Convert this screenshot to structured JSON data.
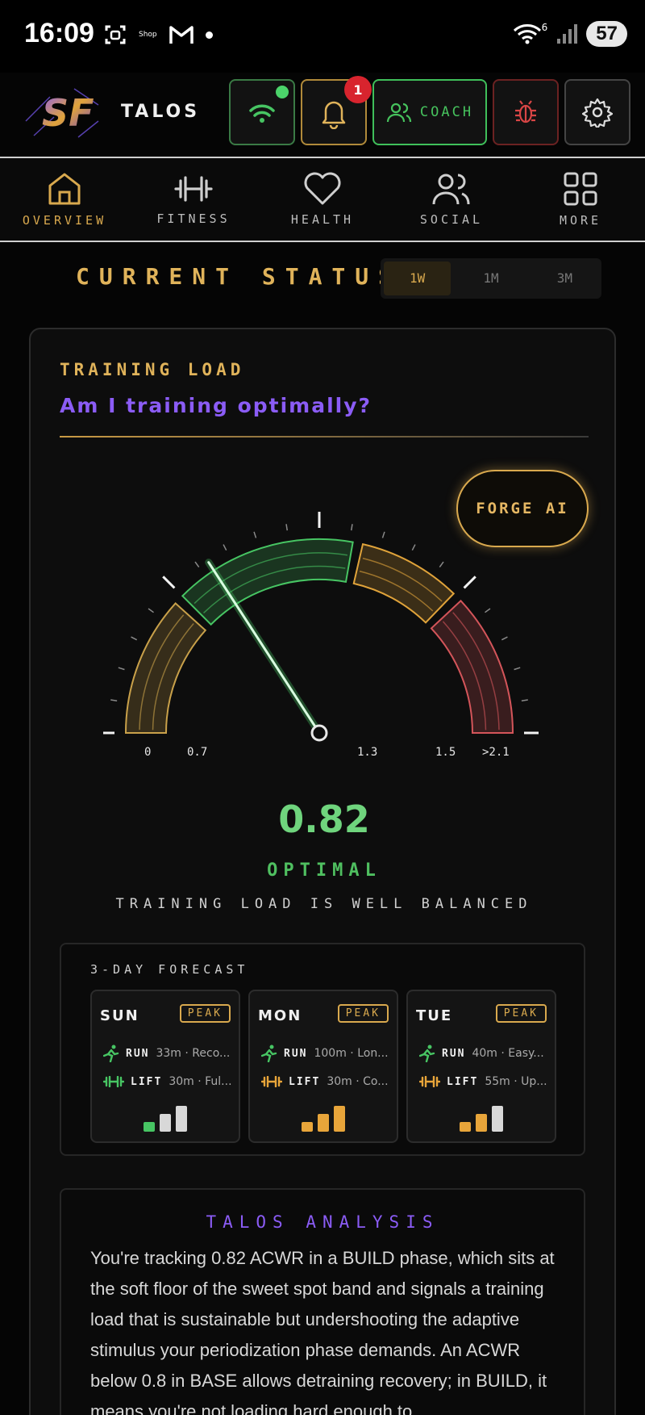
{
  "status_bar": {
    "time": "16:09",
    "shop_label": "Shop",
    "signal_label": "6",
    "battery": "57"
  },
  "header": {
    "app_name": "TALOS",
    "notification_count": "1",
    "coach_label": "COACH"
  },
  "nav": [
    {
      "label": "OVERVIEW",
      "active": true
    },
    {
      "label": "FITNESS",
      "active": false
    },
    {
      "label": "HEALTH",
      "active": false
    },
    {
      "label": "SOCIAL",
      "active": false
    },
    {
      "label": "MORE",
      "active": false
    }
  ],
  "section": {
    "title": "CURRENT STATUS",
    "ranges": [
      "1W",
      "1M",
      "3M"
    ],
    "selected_range": "1W"
  },
  "training_load": {
    "eyebrow": "TRAINING LOAD",
    "question": "Am I training optimally?",
    "scale_labels": [
      "0",
      "0.7",
      "1.3",
      "1.5",
      ">2.1"
    ],
    "value": "0.82",
    "status": "OPTIMAL",
    "description": "TRAINING LOAD IS WELL BALANCED",
    "forge_label": "FORGE AI",
    "colors": {
      "under": "#c9a14a",
      "optimal": "#47c563",
      "caution": "#e0a33a",
      "danger": "#d4555a"
    }
  },
  "forecast": {
    "title": "3-DAY FORECAST",
    "days": [
      {
        "day": "SUN",
        "badge": "PEAK",
        "run_label": "RUN",
        "run_detail": "33m · Reco...",
        "lift_label": "LIFT",
        "lift_detail": "30m · Ful...",
        "bar_color": "#47c563"
      },
      {
        "day": "MON",
        "badge": "PEAK",
        "run_label": "RUN",
        "run_detail": "100m · Lon...",
        "lift_label": "LIFT",
        "lift_detail": "30m · Co...",
        "bar_color": "#e8a53a"
      },
      {
        "day": "TUE",
        "badge": "PEAK",
        "run_label": "RUN",
        "run_detail": "40m · Easy...",
        "lift_label": "LIFT",
        "lift_detail": "55m · Up...",
        "bar_color": "#e8a53a"
      }
    ]
  },
  "analysis": {
    "title": "TALOS ANALYSIS",
    "text": "You're tracking 0.82 ACWR in a BUILD phase, which sits at the soft floor of the sweet spot band and signals a training load that is sustainable but undershooting the adaptive stimulus your periodization phase demands. An ACWR below 0.8 in BASE allows detraining recovery; in BUILD, it means you're not loading hard enough to"
  }
}
